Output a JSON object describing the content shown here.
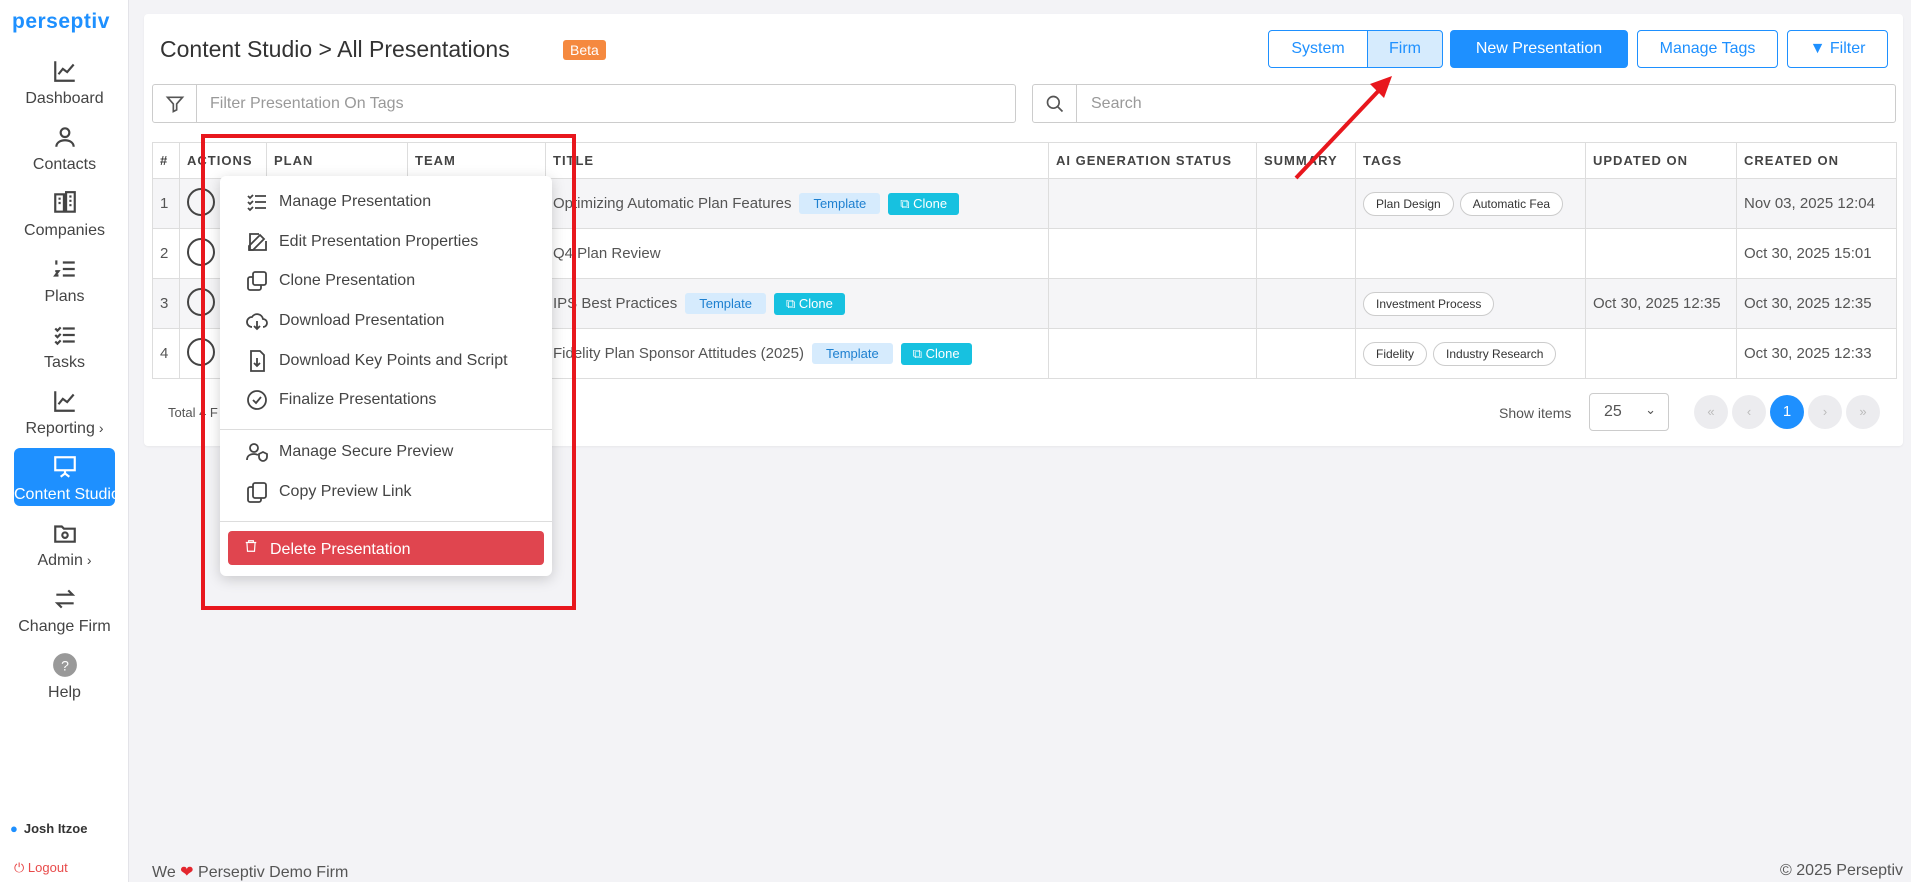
{
  "app": {
    "logo": "perseptiv"
  },
  "sidebar": {
    "items": [
      {
        "label": "Dashboard",
        "icon": "chart-line-icon"
      },
      {
        "label": "Contacts",
        "icon": "user-icon"
      },
      {
        "label": "Companies",
        "icon": "building-icon"
      },
      {
        "label": "Plans",
        "icon": "list-ordered-icon"
      },
      {
        "label": "Tasks",
        "icon": "checklist-icon"
      },
      {
        "label": "Reporting",
        "icon": "chart-line-icon",
        "chevron": "›"
      },
      {
        "label": "Content Studio",
        "icon": "presentation-icon",
        "active": true
      },
      {
        "label": "Admin",
        "icon": "folder-gear-icon",
        "chevron": "›"
      },
      {
        "label": "Change Firm",
        "icon": "swap-icon"
      },
      {
        "label": "Help",
        "icon": "help-icon"
      }
    ],
    "user": "Josh Itzoe",
    "logout": "Logout"
  },
  "header": {
    "title": "Content Studio > All Presentations",
    "badge": "Beta",
    "toggle": {
      "system": "System",
      "firm": "Firm",
      "selected": "Firm"
    },
    "new_presentation": "New Presentation",
    "manage_tags": "Manage Tags",
    "filter": "Filter"
  },
  "filters": {
    "tag_placeholder": "Filter Presentation On Tags",
    "search_placeholder": "Search"
  },
  "table": {
    "columns": [
      "#",
      "ACTIONS",
      "PLAN",
      "TEAM",
      "TITLE",
      "AI GENERATION STATUS",
      "SUMMARY",
      "TAGS",
      "UPDATED ON",
      "CREATED ON"
    ],
    "rows": [
      {
        "num": "1",
        "title": "Optimizing Automatic Plan Features",
        "template": "Template",
        "clone": "Clone",
        "tags": [
          "Plan Design",
          "Automatic Fea"
        ],
        "updated": "",
        "created": "Nov 03, 2025 12:04"
      },
      {
        "num": "2",
        "title": "Q4 Plan Review",
        "template": "",
        "clone": "",
        "tags": [],
        "updated": "",
        "created": "Oct 30, 2025 15:01"
      },
      {
        "num": "3",
        "title": "IPS Best Practices",
        "template": "Template",
        "clone": "Clone",
        "tags": [
          "Investment Process"
        ],
        "updated": "Oct 30, 2025 12:35",
        "created": "Oct 30, 2025 12:35"
      },
      {
        "num": "4",
        "title": "Fidelity Plan Sponsor Attitudes (2025)",
        "template": "Template",
        "clone": "Clone",
        "tags": [
          "Fidelity",
          "Industry Research"
        ],
        "updated": "",
        "created": "Oct 30, 2025 12:33"
      }
    ]
  },
  "pagination": {
    "total_prefix": "Total 4 F",
    "show_items": "Show items",
    "page_size": "25",
    "current_page": "1",
    "first": "«",
    "prev": "‹",
    "next": "›",
    "last": "»"
  },
  "context_menu": {
    "items": [
      {
        "label": "Manage Presentation",
        "icon": "list-check-icon"
      },
      {
        "label": "Edit Presentation Properties",
        "icon": "edit-icon"
      },
      {
        "label": "Clone Presentation",
        "icon": "copy-icon"
      },
      {
        "label": "Download Presentation",
        "icon": "cloud-download-icon"
      },
      {
        "label": "Download Key Points and Script",
        "icon": "file-download-icon"
      },
      {
        "label": "Finalize Presentations",
        "icon": "check-circle-icon"
      },
      {
        "label": "Manage Secure Preview",
        "icon": "user-shield-icon"
      },
      {
        "label": "Copy Preview Link",
        "icon": "copy-icon"
      }
    ],
    "delete": "Delete Presentation"
  },
  "footer": {
    "left_prefix": "We",
    "left_suffix": "Perseptiv Demo Firm",
    "right": "© 2025 Perseptiv"
  },
  "colors": {
    "accent": "#1e90ff",
    "beta": "#f5893f",
    "danger": "#e0454f",
    "annotation": "#e8171d"
  }
}
